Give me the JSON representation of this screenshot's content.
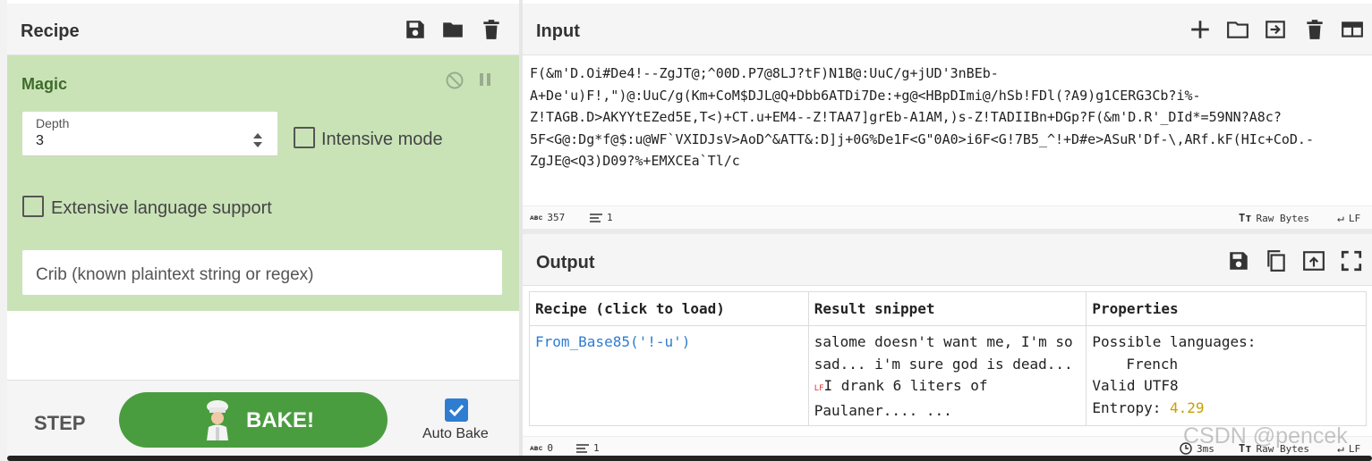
{
  "recipe": {
    "title": "Recipe",
    "operation": {
      "name": "Magic",
      "depth_label": "Depth",
      "depth_value": "3",
      "intensive_mode_label": "Intensive mode",
      "intensive_mode_checked": false,
      "extensive_language_label": "Extensive language support",
      "extensive_language_checked": false,
      "crib_placeholder": "Crib (known plaintext string or regex)"
    },
    "footer": {
      "step_label": "STEP",
      "bake_label": "BAKE!",
      "auto_bake_label": "Auto Bake",
      "auto_bake_checked": true
    }
  },
  "input": {
    "title": "Input",
    "text": "F(&m'D.Oi#De4!--ZgJT@;^00D.P7@8LJ?tF)N1B@:UuC/g+jUD'3nBEb-\nA+De'u)F!,\")@:UuC/g(Km+CoM$DJL@Q+Dbb6ATDi7De:+g@<HBpDImi@/hSb!FDl(?A9)g1CERG3Cb?i%-\nZ!TAGB.D>AKYYtEZed5E,T<)+CT.u+EM4--Z!TAA7]grEb-A1AM,)s-Z!TADIIBn+DGp?F(&m'D.R'_DId*=59NN?A8c?\n5F<G@:Dg*f@$:u@WF`VXIDJsV>AoD^&ATT&:D]j+0G%De1F<G\"0A0>i6F<G!7B5_^!+D#e>ASuR'Df-\\,ARf.kF(HIc+CoD.-\nZgJE@<Q3)D09?%+EMXCEa`Tl/c",
    "status": {
      "length_label": "357",
      "lines_label": "1",
      "raw_bytes_label": "Raw Bytes",
      "eol_label": "LF"
    }
  },
  "output": {
    "title": "Output",
    "table": {
      "headers": [
        "Recipe (click to load)",
        "Result snippet",
        "Properties"
      ],
      "rows": [
        {
          "recipe": "From_Base85('!-u')",
          "snippet_line1": "salome doesn't want me, I'm so",
          "snippet_line2": "sad... i'm sure god is dead...",
          "snippet_lf": "LF",
          "snippet_line3": "I drank 6 liters of",
          "snippet_line4": "Paulaner.... ...",
          "prop_languages": "Possible languages:",
          "prop_language_1": "French",
          "prop_valid": "Valid UTF8",
          "prop_entropy_label": "Entropy: ",
          "prop_entropy_value": "4.29"
        }
      ]
    },
    "status": {
      "length_label": "0",
      "lines_label": "1",
      "time_label": "3ms",
      "raw_bytes_label": "Raw Bytes",
      "eol_label": "LF"
    }
  },
  "watermark": "CSDN @pencek",
  "colors": {
    "operation_bg": "#c9e3b7",
    "bake_green": "#4a9d3f",
    "link_blue": "#2f7dd1",
    "entropy_gold": "#c8a000"
  }
}
